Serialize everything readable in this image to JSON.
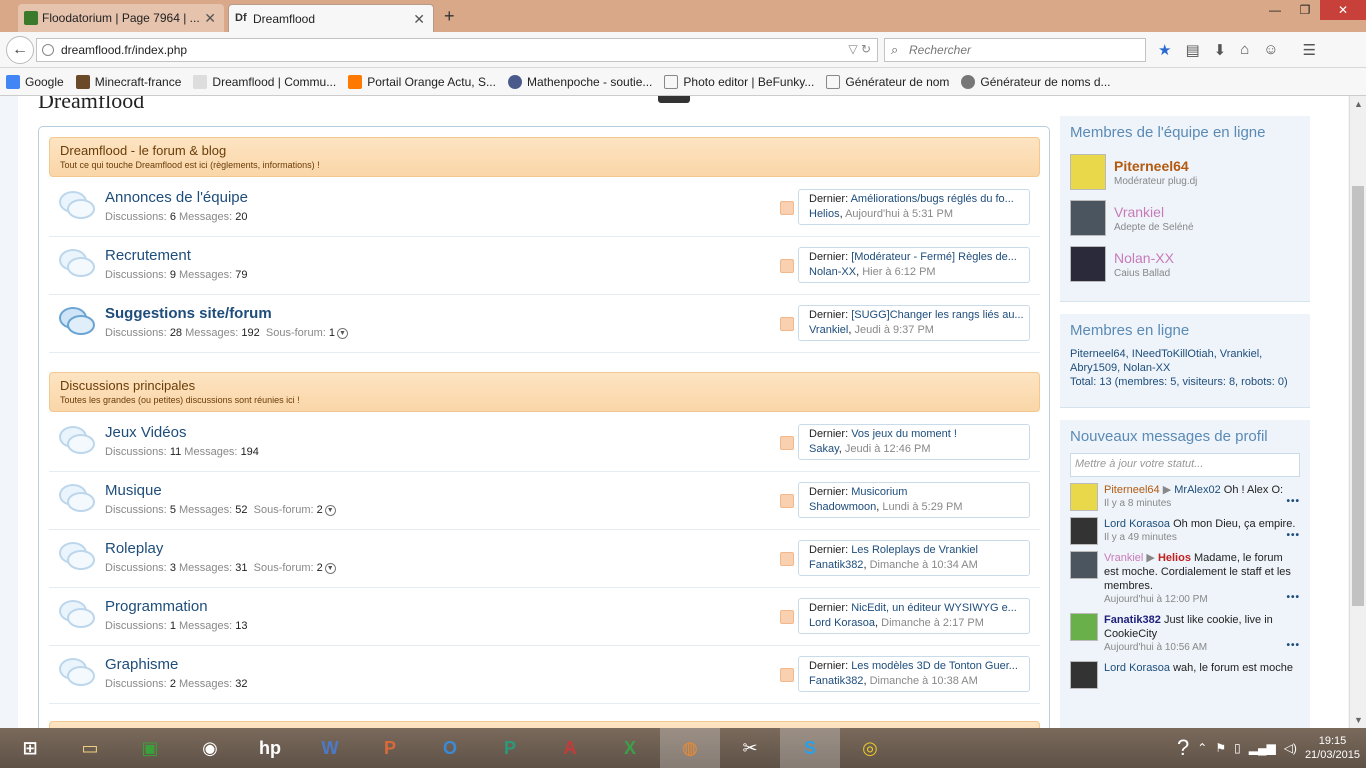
{
  "browser": {
    "tabs": [
      {
        "label": "Floodatorium | Page 7964 | ...",
        "active": false,
        "icon": "floodatorium-favicon"
      },
      {
        "label": "Dreamflood",
        "active": true,
        "icon": "dreamflood-favicon"
      }
    ],
    "url": "dreamflood.fr/index.php",
    "search_placeholder": "Rechercher",
    "bookmarks": [
      {
        "label": "Google",
        "icon": "google-icon",
        "color": "#4285f4"
      },
      {
        "label": "Minecraft-france",
        "icon": "minecraft-icon",
        "color": "#6b4a2a"
      },
      {
        "label": "Dreamflood | Commu...",
        "icon": "dreamflood-icon",
        "color": "#333333"
      },
      {
        "label": "Portail Orange  Actu, S...",
        "icon": "orange-icon",
        "color": "#ff7900"
      },
      {
        "label": "Mathenpoche - soutie...",
        "icon": "mathenpoche-icon",
        "color": "#4a5a8a"
      },
      {
        "label": "Photo editor | BeFunky...",
        "icon": "page-icon",
        "color": "#ffffff"
      },
      {
        "label": "Générateur de nom",
        "icon": "page-icon",
        "color": "#ffffff"
      },
      {
        "label": "Générateur de noms d...",
        "icon": "gear-icon",
        "color": "#555555"
      }
    ]
  },
  "site": {
    "title": "Dreamflood"
  },
  "categories": [
    {
      "title": "Dreamflood - le forum & blog",
      "desc": "Tout ce qui touche Dreamflood est ici (règlements, informations) !",
      "nodes": [
        {
          "title": "Annonces de l'équipe",
          "discussions": "6",
          "messages": "20",
          "subforum": "",
          "last_title": "Améliorations/bugs réglés du fo...",
          "last_user": "Helios",
          "last_time": "Aujourd'hui à 5:31 PM",
          "bold": false
        },
        {
          "title": "Recrutement",
          "discussions": "9",
          "messages": "79",
          "subforum": "",
          "last_title": "[Modérateur - Fermé] Règles de...",
          "last_user": "Nolan-XX",
          "last_time": "Hier à 6:12 PM",
          "bold": false
        },
        {
          "title": "Suggestions site/forum",
          "discussions": "28",
          "messages": "192",
          "subforum": "1",
          "last_title": "[SUGG]Changer les rangs liés au...",
          "last_user": "Vrankiel",
          "last_time": "Jeudi à 9:37 PM",
          "bold": true
        }
      ]
    },
    {
      "title": "Discussions principales",
      "desc": "Toutes les grandes (ou petites) discussions sont réunies ici !",
      "nodes": [
        {
          "title": "Jeux Vidéos",
          "discussions": "11",
          "messages": "194",
          "subforum": "",
          "last_title": "Vos jeux du moment !",
          "last_user": "Sakay",
          "last_time": "Jeudi à 12:46 PM",
          "bold": false
        },
        {
          "title": "Musique",
          "discussions": "5",
          "messages": "52",
          "subforum": "2",
          "last_title": "Musicorium",
          "last_user": "Shadowmoon",
          "last_time": "Lundi à 5:29 PM",
          "bold": false
        },
        {
          "title": "Roleplay",
          "discussions": "3",
          "messages": "31",
          "subforum": "2",
          "last_title": "Les Roleplays de Vrankiel",
          "last_user": "Fanatik382",
          "last_time": "Dimanche à 10:34 AM",
          "bold": false
        },
        {
          "title": "Programmation",
          "discussions": "1",
          "messages": "13",
          "subforum": "",
          "last_title": "NicEdit, un éditeur WYSIWYG e...",
          "last_user": "Lord Korasoa",
          "last_time": "Dimanche à 2:17 PM",
          "bold": false
        },
        {
          "title": "Graphisme",
          "discussions": "2",
          "messages": "32",
          "subforum": "",
          "last_title": "Les modèles 3D de Tonton Guer...",
          "last_user": "Fanatik382",
          "last_time": "Dimanche à 10:38 AM",
          "bold": false
        }
      ]
    }
  ],
  "labels": {
    "discussions": "Discussions:",
    "messages": "Messages:",
    "subforum": "Sous-forum:",
    "last": "Dernier:"
  },
  "sidebar": {
    "staff_title": "Membres de l'équipe en ligne",
    "staff": [
      {
        "name": "Piterneel64",
        "role": "Modérateur plug.dj",
        "color": "#b35a10",
        "avatar": "#e8d84a"
      },
      {
        "name": "Vrankiel",
        "role": "Adepte de Seléné",
        "color": "#c87ab8",
        "avatar": "#4a5560"
      },
      {
        "name": "Nolan-XX",
        "role": "Caius Ballad",
        "color": "#c87ab8",
        "avatar": "#2a2a3a"
      }
    ],
    "online_title": "Membres en ligne",
    "online_list": "Piterneel64, INeedToKillOtiah, Vrankiel, Abry1509, Nolan-XX",
    "online_total": "Total: 13 (membres: 5, visiteurs: 8, robots: 0)",
    "profile_title": "Nouveaux messages de profil",
    "status_placeholder": "Mettre à jour votre statut...",
    "profile_posts": [
      {
        "from": "Piterneel64",
        "to": "MrAlex02",
        "text": "Oh ! Alex O:",
        "time": "Il y a 8 minutes",
        "avatar": "#e8d84a",
        "color": "#b35a10"
      },
      {
        "from": "Lord Korasoa",
        "to": "",
        "text": "Oh mon Dieu, ça empire.",
        "time": "Il y a 49 minutes",
        "avatar": "#333333",
        "color": "#1e4d7b"
      },
      {
        "from": "Vrankiel",
        "to": "Helios",
        "text": "Madame, le forum est moche. Cordialement le staff et les membres.",
        "time": "Aujourd'hui à 12:00 PM",
        "avatar": "#4a5560",
        "color": "#c87ab8"
      },
      {
        "from": "Fanatik382",
        "to": "",
        "text": "Just like cookie, live in CookieCity",
        "time": "Aujourd'hui à 10:56 AM",
        "avatar": "#6ab04a",
        "color": "#1e4d7b"
      },
      {
        "from": "Lord Korasoa",
        "to": "",
        "text": "wah, le forum est moche",
        "time": "",
        "avatar": "#333333",
        "color": "#1e4d7b"
      }
    ]
  },
  "taskbar": {
    "time": "19:15",
    "date": "21/03/2015"
  }
}
